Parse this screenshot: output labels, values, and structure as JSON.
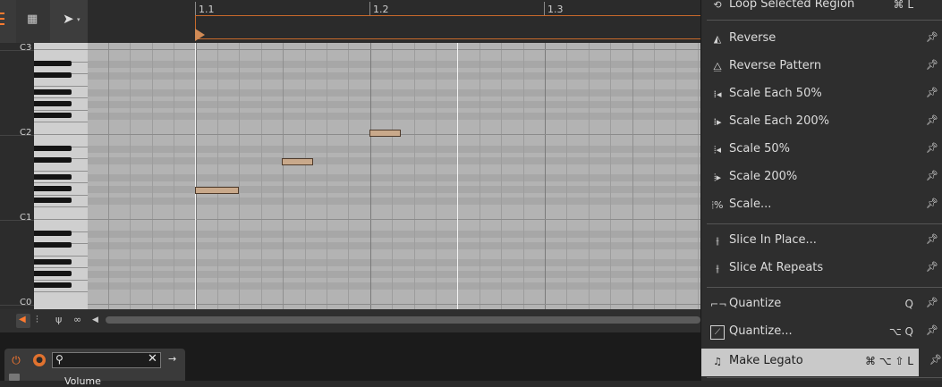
{
  "ruler": {
    "marks": [
      "1.1",
      "1.2",
      "1.3"
    ]
  },
  "keyboard": {
    "octaves": [
      "C3",
      "C2",
      "C1",
      "C0"
    ]
  },
  "browser": {
    "search_placeholder": "",
    "item_label": "Volume"
  },
  "menu": {
    "items": [
      {
        "label": "Loop Selected Region",
        "shortcut": "⌘ L",
        "icon": "loop-icon"
      },
      {
        "label": "Reverse",
        "shortcut": "",
        "icon": "reverse-icon"
      },
      {
        "label": "Reverse Pattern",
        "shortcut": "",
        "icon": "reverse-pattern-icon"
      },
      {
        "label": "Scale Each 50%",
        "shortcut": "",
        "icon": "scale-each-50-icon"
      },
      {
        "label": "Scale Each 200%",
        "shortcut": "",
        "icon": "scale-each-200-icon"
      },
      {
        "label": "Scale 50%",
        "shortcut": "",
        "icon": "scale-50-icon"
      },
      {
        "label": "Scale 200%",
        "shortcut": "",
        "icon": "scale-200-icon"
      },
      {
        "label": "Scale...",
        "shortcut": "",
        "icon": "scale-icon"
      },
      {
        "label": "Slice In Place...",
        "shortcut": "",
        "icon": "slice-in-place-icon"
      },
      {
        "label": "Slice At Repeats",
        "shortcut": "",
        "icon": "slice-at-repeats-icon"
      },
      {
        "label": "Quantize",
        "shortcut": "Q",
        "icon": "quantize-icon"
      },
      {
        "label": "Quantize...",
        "shortcut": "⌥ Q",
        "icon": "quantize-dialog-icon"
      },
      {
        "label": "Make Legato",
        "shortcut": "⌘ ⌥ ⇧ L",
        "icon": "legato-icon"
      }
    ]
  },
  "colors": {
    "accent": "#ff7a2f",
    "note_fill": "#c9a98b",
    "menu_highlight": "#c9c9c9"
  }
}
